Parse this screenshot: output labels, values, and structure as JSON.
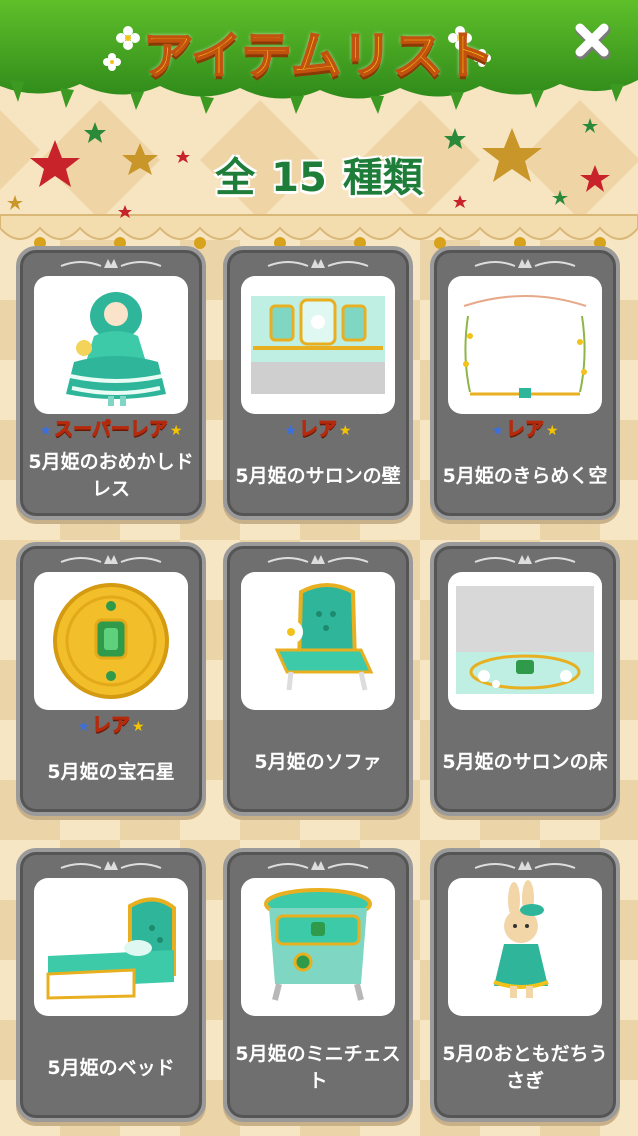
{
  "header": {
    "title": "アイテムリスト",
    "count_prefix": "全",
    "count": "15",
    "count_suffix": "種類",
    "close_icon": "close-x-icon"
  },
  "items": [
    {
      "name": "5月姫のおめかしドレス",
      "badge": "スーパーレア",
      "icon": "dress-icon"
    },
    {
      "name": "5月姫のサロンの壁",
      "badge": "レア",
      "icon": "salon-wall-icon"
    },
    {
      "name": "5月姫のきらめく空",
      "badge": "レア",
      "icon": "sky-frame-icon"
    },
    {
      "name": "5月姫の宝石星",
      "badge": "レア",
      "icon": "jewel-star-icon"
    },
    {
      "name": "5月姫のソファ",
      "badge": "",
      "icon": "sofa-icon"
    },
    {
      "name": "5月姫のサロンの床",
      "badge": "",
      "icon": "salon-floor-icon"
    },
    {
      "name": "5月姫のベッド",
      "badge": "",
      "icon": "bed-icon"
    },
    {
      "name": "5月姫のミニチェスト",
      "badge": "",
      "icon": "chest-icon"
    },
    {
      "name": "5月のおともだちうさぎ",
      "badge": "",
      "icon": "rabbit-icon"
    }
  ],
  "colors": {
    "card_bg": "#6f6f6f",
    "accent_green": "#1f7d3a",
    "mint": "#2fb69a",
    "gold": "#e8b020"
  }
}
